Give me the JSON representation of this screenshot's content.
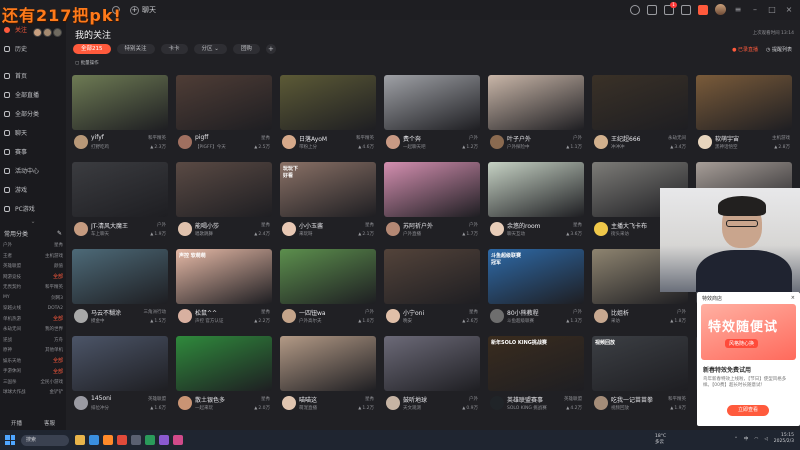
{
  "overlay_caption": "还有217把pk!",
  "titlebar": {
    "chat_label": "聊天"
  },
  "sidebar": {
    "follow_label": "关注",
    "items": [
      {
        "label": "历史"
      },
      {
        "label": "首页"
      },
      {
        "label": "全部直播"
      },
      {
        "label": "全部分类"
      },
      {
        "label": "聊天"
      },
      {
        "label": "赛事"
      },
      {
        "label": "活动中心"
      },
      {
        "label": "游戏"
      },
      {
        "label": "PC游戏"
      }
    ],
    "common_categories_label": "常用分类",
    "categories": [
      [
        "户外",
        "星秀"
      ],
      [
        "王者",
        "主机游戏"
      ],
      [
        "英雄联盟",
        "颜值"
      ],
      [
        "网游竞技",
        "全部"
      ],
      [
        "无畏契约",
        "和平精英"
      ],
      [
        "MY",
        "剑网3"
      ],
      [
        "穿越火线",
        "DOTA2"
      ],
      [
        "单机热游",
        "全部"
      ],
      [
        "永劫无间",
        "我的世界"
      ],
      [
        "逆战",
        "方舟"
      ],
      [
        "原神",
        "其他单机"
      ],
      [
        "娱乐天地",
        "全部"
      ],
      [
        "手游休闲",
        "全部"
      ],
      [
        "三国杀",
        "全民小游戏"
      ],
      [
        "球球大作战",
        "金铲铲"
      ]
    ],
    "bottom": [
      "开播",
      "客服"
    ]
  },
  "main": {
    "title": "我的关注",
    "top_right_note": "上次观看时间 13:14",
    "filters": [
      {
        "label": "全部215",
        "active": true
      },
      {
        "label": "特别关注",
        "active": false
      },
      {
        "label": "卡卡",
        "active": false
      },
      {
        "label": "分区",
        "active": false
      },
      {
        "label": "团购",
        "active": false
      }
    ],
    "add_filter": "+",
    "recorded_label": "已录直播",
    "reminder_label": "提醒列表",
    "batch_label": "批量操作"
  },
  "cards": [
    {
      "streamer": "yifyf",
      "cat": "和平精英",
      "title": "打野吃鸡",
      "viewers": "2.3万",
      "bg": "#6e7b54",
      "av": "#b89878"
    },
    {
      "streamer": "pigff",
      "cat": "星秀",
      "title": "【PIGFF】今天",
      "viewers": "2.5万",
      "bg": "#4f3d36",
      "av": "#a07060"
    },
    {
      "streamer": "日落AyoM",
      "cat": "和平精英",
      "title": "带粉上分",
      "viewers": "4.6万",
      "bg": "#5c5a36",
      "av": "#d6a98a"
    },
    {
      "streamer": "费个奔",
      "cat": "户外",
      "title": "一起聊天吧",
      "viewers": "1.2万",
      "bg": "#9fa1a6",
      "av": "#c99a84"
    },
    {
      "streamer": "叶子户外",
      "cat": "户外",
      "title": "户外探险中",
      "viewers": "1.1万",
      "bg": "#c9b6a8",
      "av": "#8a6a50"
    },
    {
      "streamer": "王纪超666",
      "cat": "永劫无间",
      "title": "冲冲冲",
      "viewers": "3.4万",
      "bg": "#3a3127",
      "av": "#d1b08d"
    },
    {
      "streamer": "软萌宇宙",
      "cat": "主机游戏",
      "title": "黑神话悟空",
      "viewers": "2.8万",
      "bg": "#7a5b3a",
      "av": "#e8d5bd"
    },
    {
      "streamer": "JT-清风大魔王",
      "cat": "户外",
      "title": "车上聊天",
      "viewers": "1.9万",
      "bg": "#3b3c40",
      "av": "#c59b80"
    },
    {
      "streamer": "能喝小莎",
      "cat": "星秀",
      "title": "唱歌跳舞",
      "viewers": "2.4万",
      "bg": "#5a4a44",
      "av": "#e0c2ad"
    },
    {
      "streamer": "小小玉酱",
      "cat": "星秀",
      "title": "来玩呀",
      "viewers": "2.1万",
      "bg": "#8a7166",
      "av": "#e8c8b4"
    },
    {
      "streamer": "苏阿祈户外",
      "cat": "户外",
      "title": "户外直播",
      "viewers": "1.7万",
      "bg": "#d48fb0",
      "av": "#b48874"
    },
    {
      "streamer": "余悠的room",
      "cat": "星秀",
      "title": "聊天互动",
      "viewers": "3.6万",
      "bg": "#c6d2c4",
      "av": "#e8cdb9"
    },
    {
      "streamer": "主播大飞卡布",
      "cat": "户外",
      "title": "街头采访",
      "viewers": "1.4万",
      "bg": "#7d7c78",
      "av": "#f0c84a"
    },
    {
      "streamer": "",
      "cat": "",
      "title": "",
      "viewers": "",
      "bg": "#a79e98",
      "av": "#c0a090"
    },
    {
      "streamer": "马云不糊涂",
      "cat": "三角洲行动",
      "title": "摸金中",
      "viewers": "1.5万",
      "bg": "#4d6a78",
      "av": "#a8a8a8"
    },
    {
      "streamer": "松鼠^^",
      "cat": "星秀",
      "title": "声控 官方认证",
      "viewers": "2.2万",
      "bg": "#e6b9a6",
      "av": "#d8b0a0"
    },
    {
      "streamer": "一四钮wa",
      "cat": "户外",
      "title": "户外高尔夫",
      "viewers": "1.0万",
      "bg": "#5c8f4d",
      "av": "#c4a48a"
    },
    {
      "streamer": "小宁oni",
      "cat": "星秀",
      "title": "晚安",
      "viewers": "2.6万",
      "bg": "#53433a",
      "av": "#e0bfa8"
    },
    {
      "streamer": "80小熊教程",
      "cat": "户外",
      "title": "斗鱼超级联赛",
      "viewers": "1.3万",
      "bg": "#2e6aa8",
      "av": "#6e6e6e"
    },
    {
      "streamer": "比姐析",
      "cat": "户外",
      "title": "采访",
      "viewers": "1.8万",
      "bg": "#8e8470",
      "av": "#c7a890"
    },
    {
      "streamer": "",
      "cat": "",
      "title": "",
      "viewers": "",
      "bg": "#5a5f6a",
      "av": "#b29880"
    },
    {
      "streamer": "145oni",
      "cat": "英雄联盟",
      "title": "排位冲分",
      "viewers": "1.6万",
      "bg": "#4c5568",
      "av": "#9a9aa2"
    },
    {
      "streamer": "散土银色多",
      "cat": "星秀",
      "title": "一起来玩",
      "viewers": "2.0万",
      "bg": "#2f8a3c",
      "av": "#c99474"
    },
    {
      "streamer": "喵喵这",
      "cat": "星秀",
      "title": "萌宠直播",
      "viewers": "1.2万",
      "bg": "#b39a86",
      "av": "#e0c5b0"
    },
    {
      "streamer": "鼓听地球",
      "cat": "户外",
      "title": "天文观测",
      "viewers": "0.9万",
      "bg": "#6c6a78",
      "av": "#c6b4a4"
    },
    {
      "streamer": "英雄联盟赛事",
      "cat": "英雄联盟",
      "title": "SOLO KING 挑战赛",
      "viewers": "4.2万",
      "bg": "#3a2c1e",
      "av": "#202428"
    },
    {
      "streamer": "吃我一记苗苗拳",
      "cat": "和平精英",
      "title": "视频回放",
      "viewers": "1.9万",
      "bg": "#3c3f44",
      "av": "#a48c78"
    },
    {
      "streamer": "",
      "cat": "",
      "title": "",
      "viewers": "",
      "bg": "#2c2f36",
      "av": "#9a8a7a"
    }
  ],
  "thumb_overlays": {
    "9": "玩玩下\n好看",
    "15": "声控 软萌萌",
    "18": "斗鱼超级联赛\n冠军",
    "25": "新年SOLO KING挑战赛",
    "26": "视频回放"
  },
  "promo": {
    "header": "特效商店",
    "close": "×",
    "banner_text": "特效随便试",
    "banner_sub": "风格随心换",
    "title": "新春特效免费试用",
    "desc": "鸟年新春特效上线啦，【节日】使型风格多样。【00费】超长时长随意试！",
    "button": "立即查看"
  },
  "taskbar": {
    "search_label": "搜索",
    "weather": [
      "18°C",
      "多云"
    ],
    "time": "15:15",
    "date": "2025/2/3",
    "lang": "中"
  }
}
